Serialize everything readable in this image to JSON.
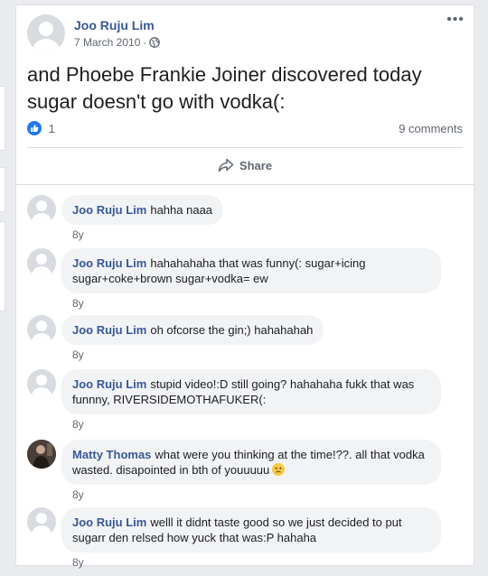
{
  "post": {
    "author": "Joo Ruju Lim",
    "date": "7 March 2010",
    "separator": "·",
    "privacy_icon": "globe-icon",
    "more_label": "•••",
    "text": "and Phoebe Frankie Joiner discovered today sugar doesn't go with vodka(:",
    "like_count": "1",
    "comments_count": "9 comments",
    "share_label": "Share"
  },
  "comments": [
    {
      "author": "Joo Ruju Lim",
      "text": "hahha naaa",
      "time": "8y"
    },
    {
      "author": "Joo Ruju Lim",
      "text": "hahahahaha that was funny(: sugar+icing sugar+coke+brown sugar+vodka= ew",
      "time": "8y"
    },
    {
      "author": "Joo Ruju Lim",
      "text": "oh ofcorse the gin;) hahahahah",
      "time": "8y"
    },
    {
      "author": "Joo Ruju Lim",
      "text": "stupid video!:D still going? hahahaha fukk that was funnny, RIVERSIDEMOTHAFUKER(:",
      "time": "8y"
    },
    {
      "author": "Matty Thomas",
      "text": "what were you thinking at the time!??. all that vodka wasted. disapointed in bth of youuuuu",
      "time": "8y"
    },
    {
      "author": "Joo Ruju Lim",
      "text": "welll it didnt taste good so we just decided to put sugarr den relsed how yuck that was:P hahaha",
      "time": "8y"
    }
  ],
  "colors": {
    "link": "#385898",
    "like": "#2078f4",
    "bubble": "#f2f3f5",
    "background": "#e9ebee"
  }
}
